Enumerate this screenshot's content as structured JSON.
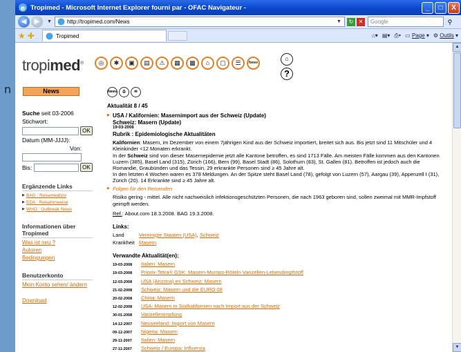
{
  "window": {
    "title": "Tropimed - Microsoft Internet Explorer fourni par - OFAC Navigateur -",
    "controls": [
      "_",
      "□",
      "X"
    ]
  },
  "address": {
    "url": "http://tropimed.com/News",
    "search_placeholder": "Google"
  },
  "tab": {
    "label": "Tropimed"
  },
  "tools": {
    "page": "Page",
    "tools": "Outils"
  },
  "desktop_char": "n",
  "logo": {
    "prefix": "tropi",
    "brand": "med",
    "mark": "®"
  },
  "nav_icons": [
    {
      "name": "globe-icon",
      "glyph": "◎"
    },
    {
      "name": "mosquito-icon",
      "glyph": "✱"
    },
    {
      "name": "vaccine-icon",
      "glyph": "▣"
    },
    {
      "name": "map-icon",
      "glyph": "▤"
    },
    {
      "name": "warning-icon",
      "glyph": "⚠"
    },
    {
      "name": "medication-icon",
      "glyph": "▦"
    },
    {
      "name": "clinic-icon",
      "glyph": "▩"
    },
    {
      "name": "house-icon",
      "glyph": "⌂"
    },
    {
      "name": "document-icon",
      "glyph": "▢"
    },
    {
      "name": "list-icon",
      "glyph": "☰"
    },
    {
      "name": "news-icon",
      "glyph": "News"
    }
  ],
  "left": {
    "news_button": "News",
    "search_title": "Suche",
    "search_since": "seit 03-2006",
    "keyword_label": "Stichwort:",
    "ok": "OK",
    "date_label": "Datum (MM-JJJJ):",
    "von": "Von:",
    "bis": "Bis:",
    "links_title": "Ergänzende Links",
    "links": [
      "BAG : Reisemedizin",
      "EDA : Reisehinweise",
      "WHO : Outbreak News"
    ],
    "info_title": "Informationen über Tropimed",
    "info_links": [
      "Was ist neu ?",
      "Autoren",
      "Bedingungen"
    ],
    "account_title": "Benutzerkonto",
    "account_link": "Mein Konto sehen/ ändern",
    "download": "Download"
  },
  "main": {
    "small_icons": [
      "News",
      "print",
      "mail"
    ],
    "counter": "Aktualität 8 / 45",
    "headline": "USA / Kalifornien: Masernimport aus der Schweiz (Update)",
    "subheadline": "Schweiz: Masern (Update)",
    "date": "19-03-2008",
    "rubrik": "Rubrik : Epidemiologische Aktualitäten",
    "para1_lead": "Kalifornien",
    "para1": ": Masern, im Dezember von einem 7jährigen Kind aus der Schweiz importiert, breitet sich aus. Bis jetzt sind 11 Mitschüler und 4 Kleinkinder <12 Monaten erkrankt.",
    "para2_pre": "In der ",
    "para2_lead": "Schweiz",
    "para2": " sind von dieser Masernepidemie jetzt alle Kantone betroffen, es sind 1713 Fälle. Am meisten Fälle kommen aus den Kantonen Luzern (385), Basel Land (315), Zürich (166), Bern (99), Basel Stadt (86), Solothurn (83), St. Gallen (81). Betroffen ist jedoch auch die Romandie, Graubünden und das Tessin. 29 erkrankte Personen sind ≥ 45 Jahre alt.",
    "para3": "In den letzten 4 Wochen waren es 378 Meldungen. An der Spitze steht Basel Land (78), gefolgt von Luzern (57), Aargau (39), Appenzell I (31), Zürich (20). 14 Erkrankte sind ≥ 45 Jahre alt.",
    "travel_heading": "Folgen für den Reisenden",
    "travel_text": "Risiko gering - mittel. Alle nicht nachweislich infektionsgeschützten Personen, die nach 1963 geboren sind, sollen zweimal mit MMR-Impfstoff geimpft werden.",
    "ref_label": "Ref.",
    "ref_text": ": About.com 18.3.2008. BAG 19.3.2008.",
    "links_title": "Links:",
    "land_label": "Land",
    "land_links": [
      "Vereinigte Staaten (USA)",
      "Schweiz"
    ],
    "land_sep": ", ",
    "disease_label": "Krankheit",
    "disease_link": "Masern",
    "related_title": "Verwandte Aktualität(en):",
    "related": [
      {
        "date": "19-03-2008",
        "title": "Italien: Masern"
      },
      {
        "date": "19-03-2008",
        "title": "Priorix-Tetra® GSK: Masern-Mumps-Röteln-Varizellen-Lebendimpfstoff"
      },
      {
        "date": "12-03-2008",
        "title": "USA (Arizona) ex Schweiz: Masern"
      },
      {
        "date": "21-02-2008",
        "title": "Schweiz: Masern und die EURO 08"
      },
      {
        "date": "20-02-2008",
        "title": "China: Masern"
      },
      {
        "date": "12-02-2008",
        "title": "USA: Masern in Südkalifornien nach Import aus der Schweiz"
      },
      {
        "date": "30-01-2008",
        "title": "Varizellenimpfung"
      },
      {
        "date": "14-12-2007",
        "title": "Neuseeland: Import von Masern"
      },
      {
        "date": "09-12-2007",
        "title": "Nigeria: Masern"
      },
      {
        "date": "29-11-2007",
        "title": "Italien: Masern"
      },
      {
        "date": "27-11-2007",
        "title": "Schweiz / Europa: Influenza"
      }
    ]
  }
}
